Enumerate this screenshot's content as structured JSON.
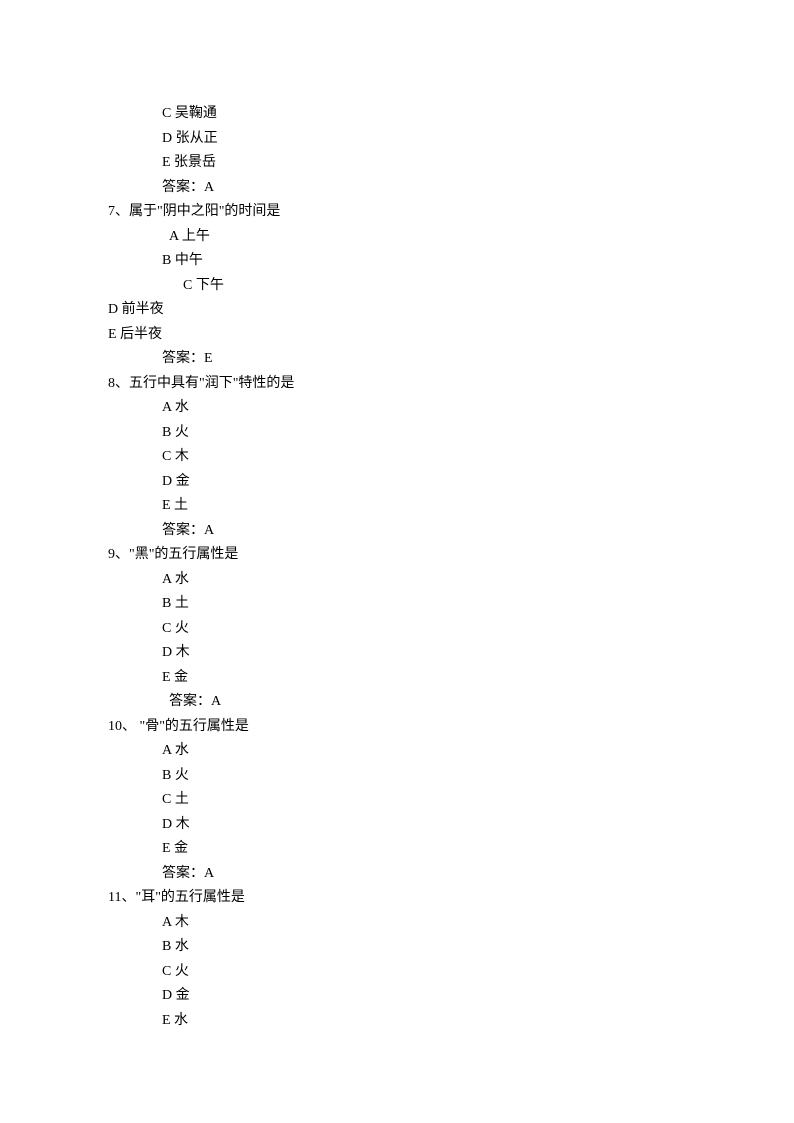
{
  "lines": [
    {
      "indent": 72,
      "text": "C 吴鞠通"
    },
    {
      "indent": 72,
      "text": "D 张从正"
    },
    {
      "indent": 72,
      "text": "E 张景岳"
    },
    {
      "indent": 72,
      "text": "答案：A"
    },
    {
      "indent": 18,
      "text": "7、属于\"阴中之阳\"的时间是"
    },
    {
      "indent": 79,
      "text": "A 上午"
    },
    {
      "indent": 72,
      "text": "B 中午"
    },
    {
      "indent": 93,
      "text": "C 下午"
    },
    {
      "indent": 18,
      "text": "D 前半夜"
    },
    {
      "indent": 18,
      "text": "E 后半夜"
    },
    {
      "indent": 72,
      "text": "答案：E"
    },
    {
      "indent": 18,
      "text": "8、五行中具有\"润下\"特性的是"
    },
    {
      "indent": 72,
      "text": "A 水"
    },
    {
      "indent": 72,
      "text": "B 火"
    },
    {
      "indent": 72,
      "text": "C 木"
    },
    {
      "indent": 72,
      "text": "D 金"
    },
    {
      "indent": 72,
      "text": "E 土"
    },
    {
      "indent": 72,
      "text": "答案：A"
    },
    {
      "indent": 18,
      "text": "9、\"黑\"的五行属性是"
    },
    {
      "indent": 72,
      "text": "A 水"
    },
    {
      "indent": 72,
      "text": "B 土"
    },
    {
      "indent": 72,
      "text": "C 火"
    },
    {
      "indent": 72,
      "text": "D 木"
    },
    {
      "indent": 72,
      "text": "E 金"
    },
    {
      "indent": 79,
      "text": "答案：A"
    },
    {
      "indent": 18,
      "text": "10、 \"骨\"的五行属性是"
    },
    {
      "indent": 72,
      "text": "A 水"
    },
    {
      "indent": 72,
      "text": "B 火"
    },
    {
      "indent": 72,
      "text": "C 土"
    },
    {
      "indent": 72,
      "text": "D 木"
    },
    {
      "indent": 72,
      "text": "E 金"
    },
    {
      "indent": 72,
      "text": "答案：A"
    },
    {
      "indent": 18,
      "text": "11、\"耳\"的五行属性是"
    },
    {
      "indent": 72,
      "text": "A 木"
    },
    {
      "indent": 72,
      "text": "B 水"
    },
    {
      "indent": 72,
      "text": "C 火"
    },
    {
      "indent": 72,
      "text": "D 金"
    },
    {
      "indent": 72,
      "text": "E 水"
    }
  ]
}
